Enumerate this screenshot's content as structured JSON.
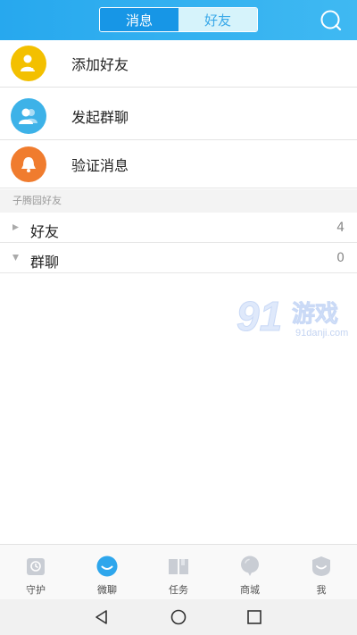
{
  "header": {
    "tabs": [
      {
        "label": "消息",
        "active": true
      },
      {
        "label": "好友",
        "active": false
      }
    ],
    "accent": "#27a8ee"
  },
  "actions": [
    {
      "label": "添加好友",
      "icon": "add-friend-icon",
      "color": "#f3c000"
    },
    {
      "label": "发起群聊",
      "icon": "group-chat-icon",
      "color": "#3db2e8"
    },
    {
      "label": "验证消息",
      "icon": "bell-icon",
      "color": "#f07c2e"
    }
  ],
  "section": {
    "title": "子腾园好友"
  },
  "groups": [
    {
      "label": "好友",
      "count": "4"
    },
    {
      "label": "群聊",
      "count": "0"
    }
  ],
  "watermark": {
    "brand_number": "91",
    "brand_text": "游戏",
    "domain": "91danji.com"
  },
  "bottom_nav": [
    {
      "label": "守护",
      "icon": "shield-clock-icon",
      "active": false
    },
    {
      "label": "微聊",
      "icon": "chat-bubble-icon",
      "active": true
    },
    {
      "label": "任务",
      "icon": "book-icon",
      "active": false
    },
    {
      "label": "商城",
      "icon": "balloon-icon",
      "active": false
    },
    {
      "label": "我",
      "icon": "profile-icon",
      "active": false
    }
  ]
}
